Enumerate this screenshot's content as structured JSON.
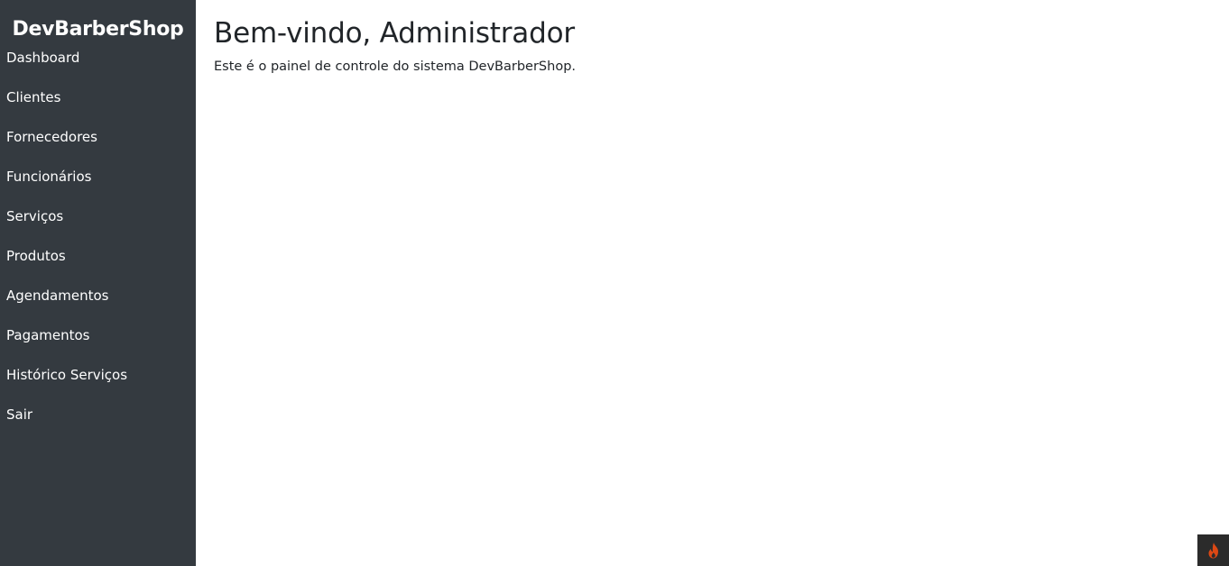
{
  "sidebar": {
    "brand": "DevBarberShop",
    "items": [
      {
        "label": "Dashboard"
      },
      {
        "label": "Clientes"
      },
      {
        "label": "Fornecedores"
      },
      {
        "label": "Funcionários"
      },
      {
        "label": "Serviços"
      },
      {
        "label": "Produtos"
      },
      {
        "label": "Agendamentos"
      },
      {
        "label": "Pagamentos"
      },
      {
        "label": "Histórico Serviços"
      },
      {
        "label": "Sair"
      }
    ]
  },
  "main": {
    "title": "Bem-vindo, Administrador",
    "description": "Este é o painel de controle do sistema DevBarberShop."
  },
  "debug_toolbar": {
    "icon": "flame-icon",
    "accent": "#dd4814"
  },
  "colors": {
    "sidebar_bg": "#343a40",
    "text": "#212529"
  }
}
